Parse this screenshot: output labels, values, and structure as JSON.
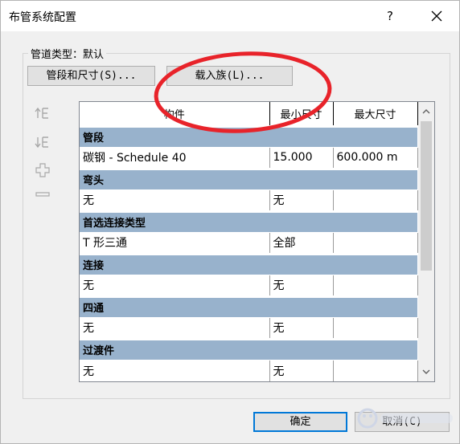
{
  "window": {
    "title": "布管系统配置",
    "help_label": "?"
  },
  "pipe_type": {
    "label": "管道类型：默认"
  },
  "buttons": {
    "segments_sizes": "管段和尺寸(S)...",
    "load_family": "载入族(L)...",
    "ok": "确定",
    "cancel": "取消(C)"
  },
  "side_icons": [
    "move-up-icon",
    "move-down-icon",
    "add-row-icon",
    "remove-row-icon"
  ],
  "table": {
    "headers": [
      "构件",
      "最小尺寸",
      "最大尺寸"
    ],
    "groups": [
      {
        "name": "管段",
        "row": [
          "碳钢 - Schedule 40",
          "15.000",
          "600.000 m"
        ]
      },
      {
        "name": "弯头",
        "row": [
          "无",
          "无",
          ""
        ]
      },
      {
        "name": "首选连接类型",
        "row": [
          "T 形三通",
          "全部",
          ""
        ]
      },
      {
        "name": "连接",
        "row": [
          "无",
          "无",
          ""
        ]
      },
      {
        "name": "四通",
        "row": [
          "无",
          "无",
          ""
        ]
      },
      {
        "name": "过渡件",
        "row": [
          "无",
          "无",
          ""
        ]
      }
    ]
  },
  "colors": {
    "group_header": "#98b2cc",
    "annotation": "#e8232a",
    "default_button_border": "#0078d7"
  }
}
